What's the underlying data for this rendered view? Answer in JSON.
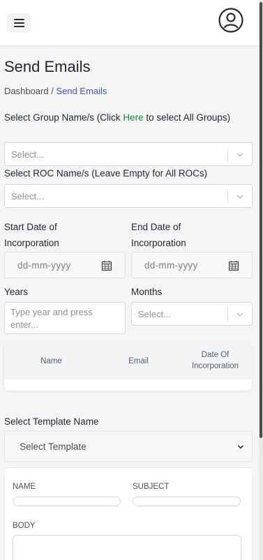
{
  "header": {
    "menu_icon": "hamburger-menu-icon",
    "profile_icon": "user-circle-icon"
  },
  "page": {
    "title": "Send Emails",
    "breadcrumb": {
      "home": "Dashboard /",
      "current": "Send Emails"
    }
  },
  "group_select": {
    "label_prefix": "Select Group Name/s (Click ",
    "label_link": "Here",
    "label_suffix": " to select All Groups)",
    "placeholder": "Select..."
  },
  "roc_select": {
    "label": "Select ROC Name/s (Leave Empty for All ROCs)",
    "placeholder": "Select..."
  },
  "start_date": {
    "label_line1": "Start Date of",
    "label_line2": "Incorporation",
    "placeholder": "dd-mm-yyyy"
  },
  "end_date": {
    "label_line1": "End Date of",
    "label_line2": "Incorporation",
    "placeholder": "dd-mm-yyyy"
  },
  "years": {
    "label": "Years",
    "placeholder": "Type year and press enter..."
  },
  "months": {
    "label": "Months",
    "placeholder": "Select..."
  },
  "table": {
    "columns": [
      "Name",
      "Email",
      "Date Of Incorporation"
    ]
  },
  "template": {
    "label": "Select Template Name",
    "selected": "Select Template"
  },
  "template_form": {
    "name_label": "NAME",
    "subject_label": "SUBJECT",
    "body_label": "BODY"
  },
  "colors": {
    "link_blue": "#3d55c8",
    "link_green": "#1a8a3a"
  }
}
